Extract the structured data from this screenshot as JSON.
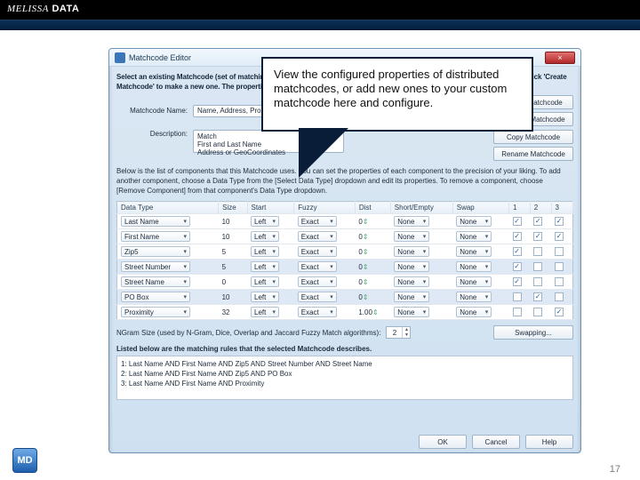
{
  "brand": {
    "left": "MELISSA",
    "right": "DATA"
  },
  "page_number": "17",
  "badge": "MD",
  "callout": {
    "text": "View the configured properties of distributed matchcodes, or add new ones to your custom matchcode here and configure."
  },
  "win": {
    "title": "Matchcode Editor",
    "close": "×",
    "intro": "Select an existing Matchcode (set of matching rules) below by choosing a name from the Matchcode Name dropdown list or click 'Create Matchcode' to make a new one. The properties below associate with this Matchcode:",
    "matchcode_name_label": "Matchcode Name:",
    "matchcode_name_value": "Name, Address, Proximity",
    "description_label": "Description:",
    "description_value": "Match\nFirst and Last Name\nAddress or GeoCoordinates",
    "buttons": {
      "create": "Create Matchcode",
      "remove": "Remove Matchcode",
      "copy": "Copy Matchcode",
      "rename": "Rename Matchcode"
    },
    "section_text": "Below is the list of components that this Matchcode uses. You can set the properties of each component to the precision of your liking. To add another component, choose a Data Type from the [Select Data Type] dropdown and edit its properties. To remove a component, choose [Remove Component] from that component's Data Type dropdown.",
    "headers": [
      "Data Type",
      "Size",
      "Start",
      "Fuzzy",
      "Dist",
      "Short/Empty",
      "Swap",
      "1",
      "2",
      "3"
    ],
    "rows": [
      {
        "type": "Last Name",
        "size": "10",
        "start": "Left",
        "fuzzy": "Exact",
        "dist": "0",
        "short": "None",
        "swap": "None",
        "c1": true,
        "c2": true,
        "c3": true,
        "hl": false
      },
      {
        "type": "First Name",
        "size": "10",
        "start": "Left",
        "fuzzy": "Exact",
        "dist": "0",
        "short": "None",
        "swap": "None",
        "c1": true,
        "c2": true,
        "c3": true,
        "hl": false
      },
      {
        "type": "Zip5",
        "size": "5",
        "start": "Left",
        "fuzzy": "Exact",
        "dist": "0",
        "short": "None",
        "swap": "None",
        "c1": true,
        "c2": false,
        "c3": false,
        "hl": false
      },
      {
        "type": "Street Number",
        "size": "5",
        "start": "Left",
        "fuzzy": "Exact",
        "dist": "0",
        "short": "None",
        "swap": "None",
        "c1": true,
        "c2": false,
        "c3": false,
        "hl": true
      },
      {
        "type": "Street Name",
        "size": "0",
        "start": "Left",
        "fuzzy": "Exact",
        "dist": "0",
        "short": "None",
        "swap": "None",
        "c1": true,
        "c2": false,
        "c3": false,
        "hl": false
      },
      {
        "type": "PO Box",
        "size": "10",
        "start": "Left",
        "fuzzy": "Exact",
        "dist": "0",
        "short": "None",
        "swap": "None",
        "c1": false,
        "c2": true,
        "c3": false,
        "hl": true
      },
      {
        "type": "Proximity",
        "size": "32",
        "start": "Left",
        "fuzzy": "Exact",
        "dist": "1.00",
        "short": "None",
        "swap": "None",
        "c1": false,
        "c2": false,
        "c3": true,
        "hl": false
      }
    ],
    "ngram_label": "NGram Size (used by N-Gram, Dice, Overlap and Jaccard Fuzzy Match algorithms):",
    "ngram_value": "2",
    "swap_btn": "Swapping...",
    "rules_header": "Listed below are the matching rules that the selected Matchcode describes.",
    "rules": [
      "1: Last Name AND First Name AND Zip5 AND Street Number AND Street Name",
      "2: Last Name AND First Name AND Zip5 AND PO Box",
      "3: Last Name AND First Name AND Proximity"
    ],
    "footer": {
      "ok": "OK",
      "cancel": "Cancel",
      "help": "Help"
    }
  }
}
